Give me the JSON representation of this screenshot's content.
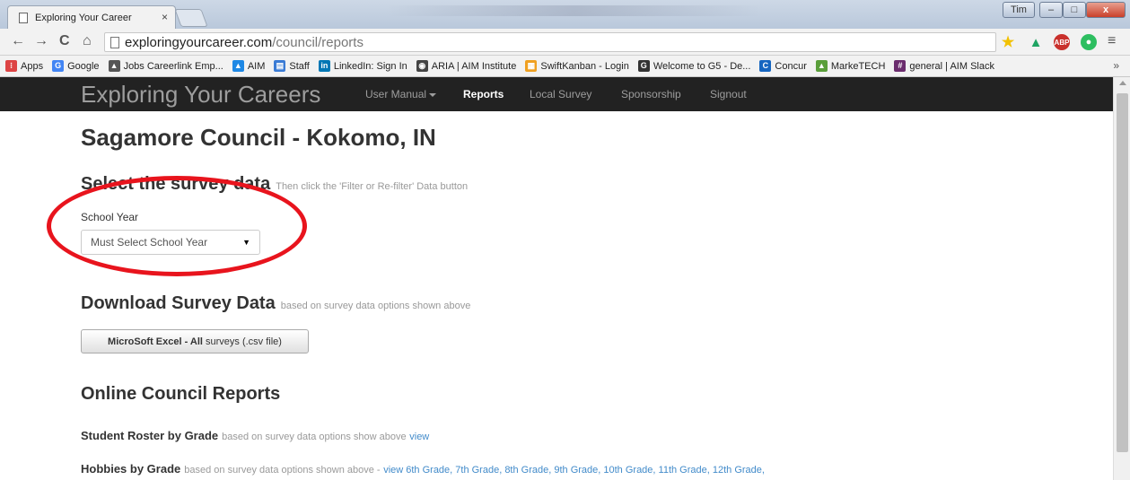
{
  "browser": {
    "tab_title": "Exploring Your Career",
    "tab_close": "×",
    "window_user_label": "Tim",
    "window_controls": {
      "minimize": "–",
      "maximize": "□",
      "close": "x"
    },
    "url_domain": "exploringyourcareer.com",
    "url_path": "/council/reports",
    "nav": {
      "back": "←",
      "forward": "→",
      "reload": "C",
      "home": "⌂"
    },
    "menu_icon": "≡",
    "extensions": [
      {
        "name": "star-icon",
        "glyph": "★",
        "color": "#f2c100"
      },
      {
        "name": "drive-icon",
        "glyph": "▲",
        "color": "#1fa463"
      },
      {
        "name": "adblock-icon",
        "glyph": "ABP",
        "color": "#c9302c"
      },
      {
        "name": "evernote-icon",
        "glyph": "●",
        "color": "#2dbe60"
      }
    ]
  },
  "bookmarks": [
    {
      "label": "Apps",
      "color": "#d44"
    },
    {
      "label": "Google",
      "color": "#4285f4"
    },
    {
      "label": "Jobs Careerlink Emp...",
      "color": "#555"
    },
    {
      "label": "AIM",
      "color": "#1e88e5"
    },
    {
      "label": "Staff",
      "color": "#3a7bd5"
    },
    {
      "label": "LinkedIn: Sign In",
      "color": "#0077b5"
    },
    {
      "label": "ARIA | AIM Institute",
      "color": "#444"
    },
    {
      "label": "SwiftKanban - Login",
      "color": "#f0a020"
    },
    {
      "label": "Welcome to G5 - De...",
      "color": "#333"
    },
    {
      "label": "Concur",
      "color": "#1565c0"
    },
    {
      "label": "MarkeTECH",
      "color": "#5a9e3a"
    },
    {
      "label": "general | AIM Slack",
      "color": "#6b2c6e"
    }
  ],
  "bookmarks_more": "»",
  "navbar": {
    "brand": "Exploring Your Careers",
    "links": [
      "User Manual",
      "Reports",
      "Local Survey",
      "Sponsorship",
      "Signout"
    ]
  },
  "page": {
    "council_name": "Sagamore Council - Kokomo, IN",
    "select_section": {
      "title": "Select the survey data",
      "hint": "Then click the 'Filter or Re-filter' Data button"
    },
    "school_year_label": "School Year",
    "school_year_value": "Must Select School Year",
    "download_section": {
      "title": "Download Survey Data",
      "hint": "based on survey data options shown above"
    },
    "excel_button": {
      "bold": "MicroSoft Excel - All",
      "rest": "surveys (.csv file)"
    },
    "online_reports_title": "Online Council Reports",
    "reports": [
      {
        "title": "Student Roster by Grade",
        "desc": "based on survey data options show above",
        "links": "view"
      },
      {
        "title": "Hobbies by Grade",
        "desc": "based on survey data options shown above -",
        "links": "view 6th Grade, 7th Grade, 8th Grade, 9th Grade, 10th Grade, 11th Grade, 12th Grade,"
      }
    ]
  }
}
